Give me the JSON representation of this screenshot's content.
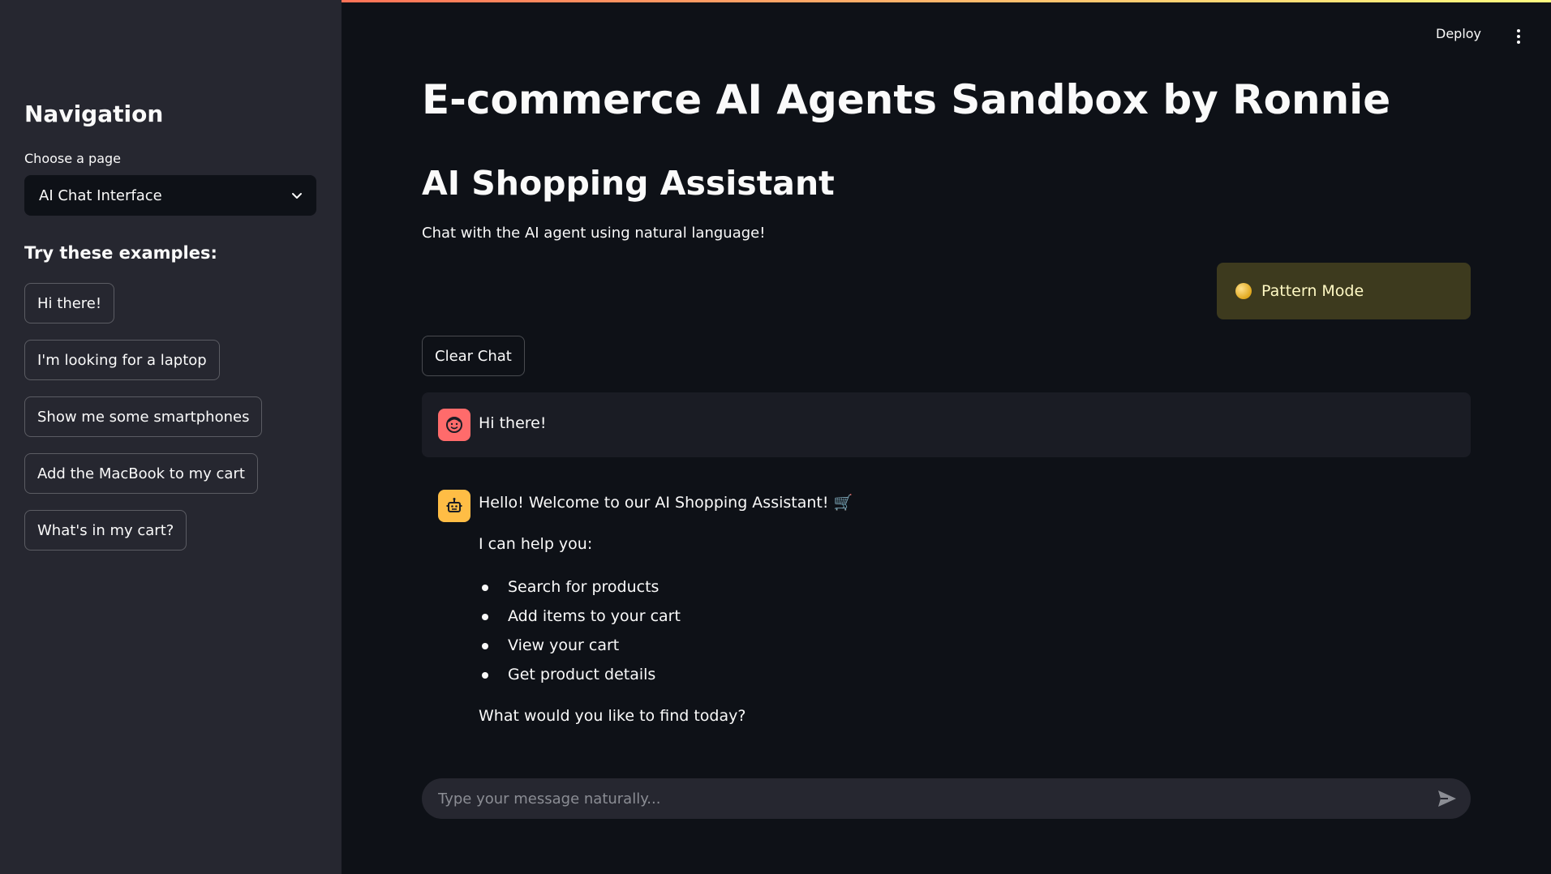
{
  "header": {
    "deploy_label": "Deploy",
    "menu_icon": "kebab-menu-icon"
  },
  "sidebar": {
    "title": "Navigation",
    "select_label": "Choose a page",
    "select_value": "AI Chat Interface",
    "examples_title": "Try these examples:",
    "examples": [
      "Hi there!",
      "I'm looking for a laptop",
      "Show me some smartphones",
      "Add the MacBook to my cart",
      "What's in my cart?"
    ]
  },
  "main": {
    "title": "E-commerce AI Agents Sandbox by Ronnie",
    "subtitle": "AI Shopping Assistant",
    "description": "Chat with the AI agent using natural language!",
    "mode_label": "Pattern Mode",
    "clear_label": "Clear Chat",
    "messages": {
      "user": {
        "text": "Hi there!",
        "avatar_icon": "user-face-icon"
      },
      "bot": {
        "greeting": "Hello! Welcome to our AI Shopping Assistant! 🛒",
        "intro": "I can help you:",
        "items": [
          "Search for products",
          "Add items to your cart",
          "View your cart",
          "Get product details"
        ],
        "closing": "What would you like to find today?",
        "avatar_icon": "robot-icon"
      }
    },
    "input": {
      "placeholder": "Type your message naturally...",
      "send_icon": "send-icon"
    }
  },
  "colors": {
    "background": "#0e1117",
    "sidebar": "#262730",
    "user_avatar": "#ff6b6b",
    "bot_avatar": "#ffbd45",
    "mode_bg": "#3d3a1e"
  }
}
